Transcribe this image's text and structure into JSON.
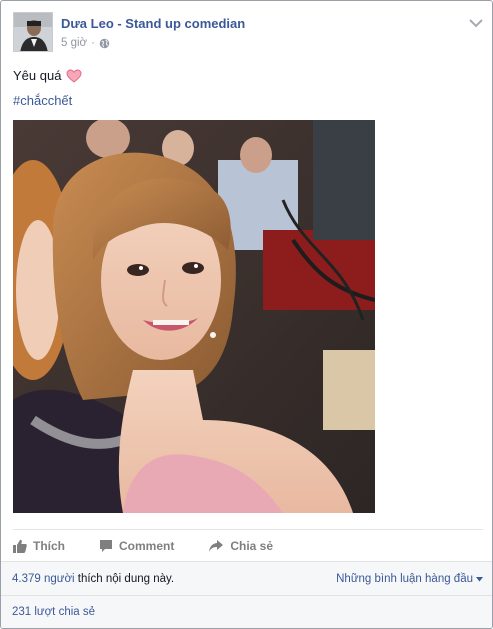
{
  "post": {
    "author": "Dưa Leo - Stand up comedian",
    "time": "5 giờ",
    "dot": "·",
    "text": "Yêu quá",
    "hashtag": "#chắcchết"
  },
  "actions": {
    "like": "Thích",
    "comment": "Comment",
    "share": "Chia sẻ"
  },
  "footer": {
    "likes_count": "4.379 người",
    "likes_rest": " thích nội dung này.",
    "sort_label": "Những bình luận hàng đầu",
    "shares": "231 lượt chia sẻ"
  },
  "colors": {
    "link": "#3b5998",
    "muted": "#9197a3",
    "heart": "#f27596"
  },
  "icons": [
    "globe-icon",
    "chevron-down-icon",
    "heart-icon",
    "like-icon",
    "comment-icon",
    "share-icon",
    "caret-down-icon"
  ]
}
